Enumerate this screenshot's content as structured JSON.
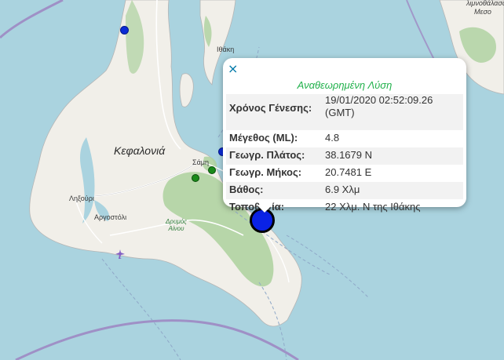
{
  "colors": {
    "sea": "#aad3df",
    "land": "#f1efe9",
    "forest": "#add19e",
    "boundary": "#9c7fbf",
    "accent_title": "#22b14c",
    "marker_blue": "#0b2bd6",
    "marker_green": "#1a8a1a"
  },
  "labels": {
    "kefalonia": "Κεφαλονιά",
    "ithaki": "Ιθάκη",
    "sami": "Σάμη",
    "lixouri": "Ληξούρι",
    "argostoli": "Αργοστόλι",
    "drymos_line1": "Δρυμός",
    "drymos_line2": "Αίνου",
    "top_right_line1": "λιμνοθάλασσα",
    "top_right_line2": "Μεσο"
  },
  "icons": {
    "airport": "airplane-icon",
    "close": "close-icon"
  },
  "markers": [
    {
      "name": "blue-earthquake-marker",
      "magnitude_class": "small",
      "color": "blue"
    },
    {
      "name": "blue-earthquake-marker",
      "magnitude_class": "small",
      "color": "blue"
    },
    {
      "name": "green-earthquake-marker",
      "magnitude_class": "small",
      "color": "green"
    },
    {
      "name": "green-earthquake-marker",
      "magnitude_class": "small",
      "color": "green"
    },
    {
      "name": "selected-earthquake-marker",
      "magnitude_class": "large",
      "color": "blue"
    }
  ],
  "popup": {
    "close_symbol": "×",
    "title": "Αναθεωρημένη Λύση",
    "rows": [
      {
        "key": "Χρόνος Γένεσης:",
        "value": "19/01/2020 02:52:09.26 (GMT)"
      },
      {
        "key": "Μέγεθος (ML):",
        "value": "4.8"
      },
      {
        "key": "Γεωγρ. Πλάτος:",
        "value": "38.1679 N"
      },
      {
        "key": "Γεωγρ. Μήκος:",
        "value": "20.7481 E"
      },
      {
        "key": "Βάθος:",
        "value": "6.9 Χλμ"
      },
      {
        "key": "Τοποθεσία:",
        "value": "22 Χλμ. Ν της Ιθάκης"
      }
    ]
  }
}
